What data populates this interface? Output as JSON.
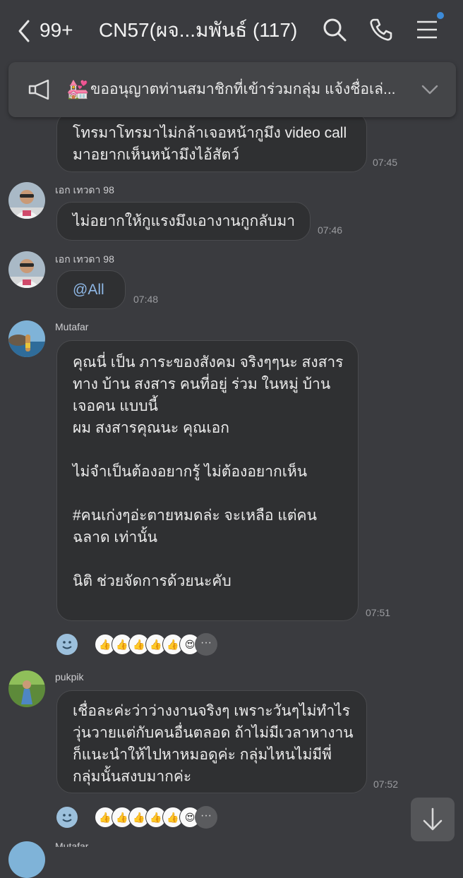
{
  "header": {
    "unread_count": "99+",
    "title": "CN57(ผจ...มพันธ์ (117)",
    "icons": [
      "chevron-left-icon",
      "search-icon",
      "phone-icon",
      "menu-icon"
    ]
  },
  "announcement": {
    "emoji": "💒",
    "text": "ขออนุญาตท่านสมาชิกที่เข้าร่วมกลุ่ม แจ้งชื่อเล่..."
  },
  "messages": [
    {
      "sender": "",
      "lines": [
        "โทรมาโทรมาไม่กล้าเจอหน้ากูมึง video call",
        "มาอยากเห็นหน้ามึงไอ้สัตว์"
      ],
      "time": "07:45"
    },
    {
      "sender": "เอก เทวดา 98",
      "lines": [
        "ไม่อยากให้กูแรงมึงเอางานกูกลับมา"
      ],
      "time": "07:46"
    },
    {
      "sender": "เอก เทวดา 98",
      "lines": [
        "@All"
      ],
      "time": "07:48"
    },
    {
      "sender": "Mutafar",
      "lines": [
        "คุณนี่ เป็น ภาระของสังคม จริงๆๆนะ สงสาร",
        "ทาง บ้าน สงสาร คนที่อยู่ ร่วม ในหมู่ บ้าน",
        "เจอคน แบบนี้",
        "ผม สงสารคุณนะ คุณเอก",
        "",
        "ไม่จำเป็นต้องอยากรู้ ไม่ต้องอยากเห็น",
        "",
        "#คนเก่งๆอ่ะตายหมดล่ะ จะเหลือ แต่คน",
        "ฉลาด เท่านั้น",
        "",
        "นิติ ช่วยจัดการด้วยนะคับ"
      ],
      "time": "07:51"
    },
    {
      "sender": "pukpik",
      "lines": [
        "เชื่อละค่ะว่าว่างงานจริงๆ เพราะวันๆไม่ทำไร",
        "วุ่นวายแต่กับคนอื่นตลอด ถ้าไม่มีเวลาหางาน",
        "ก็แนะนำให้ไปหาหมอดูค่ะ กลุ่มไหนไม่มีพี่",
        "กลุ่มนั้นสงบมากค่ะ"
      ],
      "time": "07:52"
    }
  ],
  "reactions": {
    "faces": [
      "👍",
      "👍",
      "👍",
      "👍",
      "👍",
      "😍"
    ],
    "more": "···"
  },
  "partial_sender": "Mutafar",
  "colors": {
    "background": "#3a3b3f",
    "bubble": "#2f3032",
    "accent_dot": "#3d8bd8"
  }
}
